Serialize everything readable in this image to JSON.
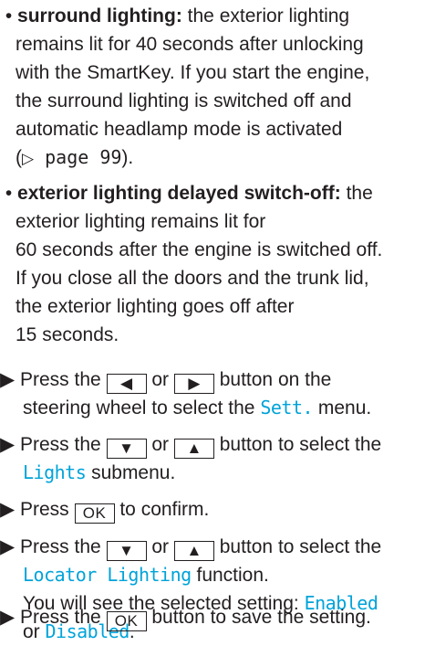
{
  "bullets": [
    {
      "term": "surround lighting:",
      "lines": [
        " the exterior lighting",
        "remains lit for 40 seconds after unlocking",
        "with the SmartKey. If you start the engine,",
        "the surround lighting is switched off and",
        "automatic headlamp mode is activated"
      ],
      "ref_open": "(",
      "ref_arrow": "▷",
      "ref_page": " page 99",
      "ref_close": ")."
    },
    {
      "term": "exterior lighting delayed switch-off:",
      "lines": [
        " the",
        "exterior lighting remains lit for",
        "60 seconds after the engine is switched off.",
        "If you close all the doors and the trunk lid,",
        "the exterior lighting goes off after",
        "15 seconds."
      ]
    }
  ],
  "step_marker": "▶",
  "steps": {
    "s1": {
      "a": "Press the ",
      "key1": "◀",
      "b": " or ",
      "key2": "▶",
      "c": " button on the",
      "d": "steering wheel to select the ",
      "menu": "Sett.",
      "e": " menu."
    },
    "s2": {
      "a": "Press the ",
      "key1": "▼",
      "b": " or ",
      "key2": "▲",
      "c": " button to select the",
      "submenu": "Lights",
      "d": " submenu."
    },
    "s3": {
      "a": "Press ",
      "key": "OK",
      "b": " to confirm."
    },
    "s4": {
      "a": "Press the ",
      "key1": "▼",
      "b": " or ",
      "key2": "▲",
      "c": " button to select the",
      "function": "Locator Lighting",
      "d": " function.",
      "e": "You will see the selected setting: ",
      "opt1": "Enabled",
      "f": "or ",
      "opt2": "Disabled",
      "g": "."
    },
    "s5": {
      "a": "Press the ",
      "key": "OK",
      "b": " button to save the setting."
    }
  },
  "colors": {
    "text": "#231f20",
    "display_text": "#00a3d9"
  }
}
